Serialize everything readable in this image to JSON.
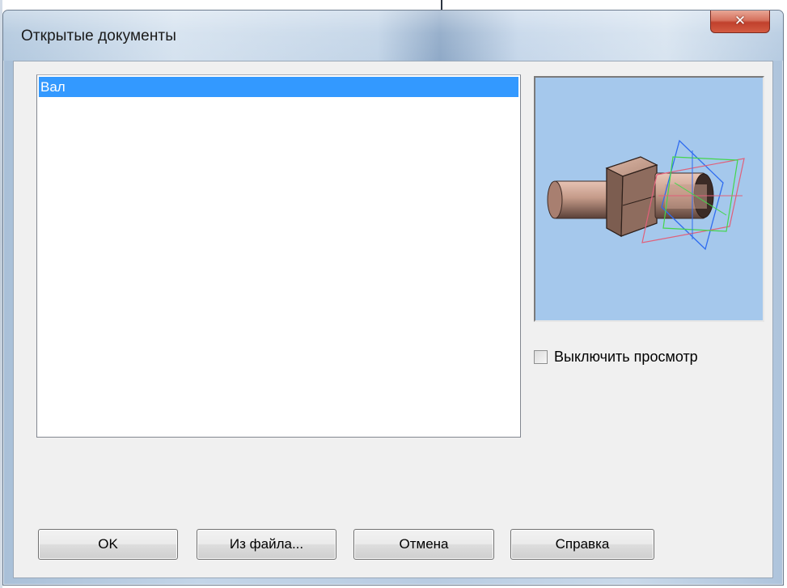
{
  "window": {
    "title": "Открытые документы",
    "close_symbol": "✕"
  },
  "document_list": {
    "items": [
      {
        "label": "Вал",
        "selected": true
      }
    ]
  },
  "preview": {
    "background_color": "#a5c8ec",
    "icon": "shaft-3d-model"
  },
  "options": {
    "disable_preview_label": "Выключить просмотр",
    "disable_preview_checked": false
  },
  "buttons": {
    "ok_label": "OK",
    "from_file_label": "Из файла...",
    "cancel_label": "Отмена",
    "help_label": "Справка"
  },
  "colors": {
    "selection": "#3399ff",
    "close_button": "#c8452f"
  }
}
